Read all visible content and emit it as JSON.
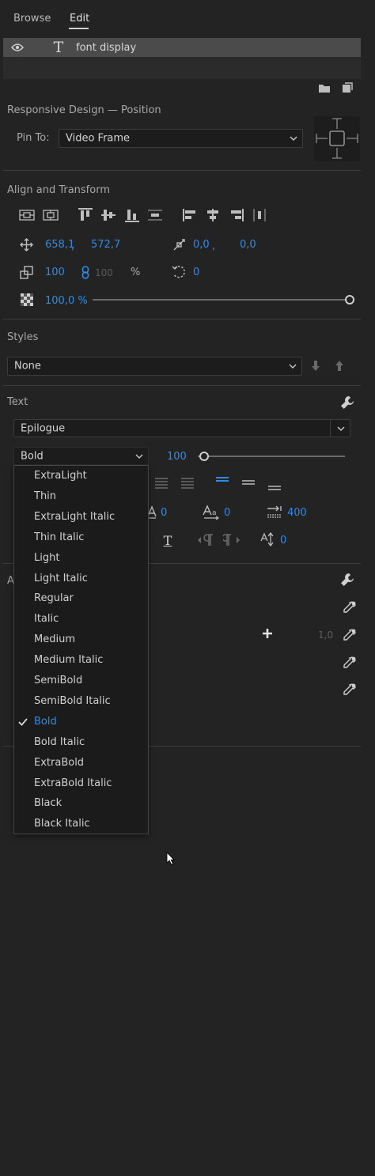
{
  "tabs": {
    "browse": "Browse",
    "edit": "Edit"
  },
  "layer": {
    "name": "font display"
  },
  "responsive": {
    "title": "Responsive Design — Position",
    "pin_label": "Pin To:",
    "pin_value": "Video Frame"
  },
  "align": {
    "title": "Align and Transform",
    "pos_x": "658,1",
    "pos_sep": ",",
    "pos_y": "572,7",
    "anchor_x": "0,0",
    "anchor_sep": ",",
    "anchor_y": "0,0",
    "scale": "100",
    "scale_locked": "100",
    "scale_unit": "%",
    "rotation": "0",
    "opacity": "100,0 %",
    "opacity_fraction": 1.0
  },
  "styles": {
    "title": "Styles",
    "value": "None"
  },
  "text": {
    "title": "Text",
    "font": "Epilogue",
    "style": "Bold",
    "size": "100",
    "kerning": "0",
    "tracking": "0",
    "leading": "400",
    "baseline": "0"
  },
  "appearance": {
    "title_fragment": "A",
    "stroke_width": "1,0"
  },
  "font_styles": [
    "ExtraLight",
    "Thin",
    "ExtraLight Italic",
    "Thin Italic",
    "Light",
    "Light Italic",
    "Regular",
    "Italic",
    "Medium",
    "Medium Italic",
    "SemiBold",
    "SemiBold Italic",
    "Bold",
    "Bold Italic",
    "ExtraBold",
    "ExtraBold Italic",
    "Black",
    "Black Italic"
  ],
  "selected_style_index": 12,
  "colors": {
    "accent": "#2d8ceb",
    "panel": "#232323",
    "layer_row": "#4b4b4b"
  }
}
